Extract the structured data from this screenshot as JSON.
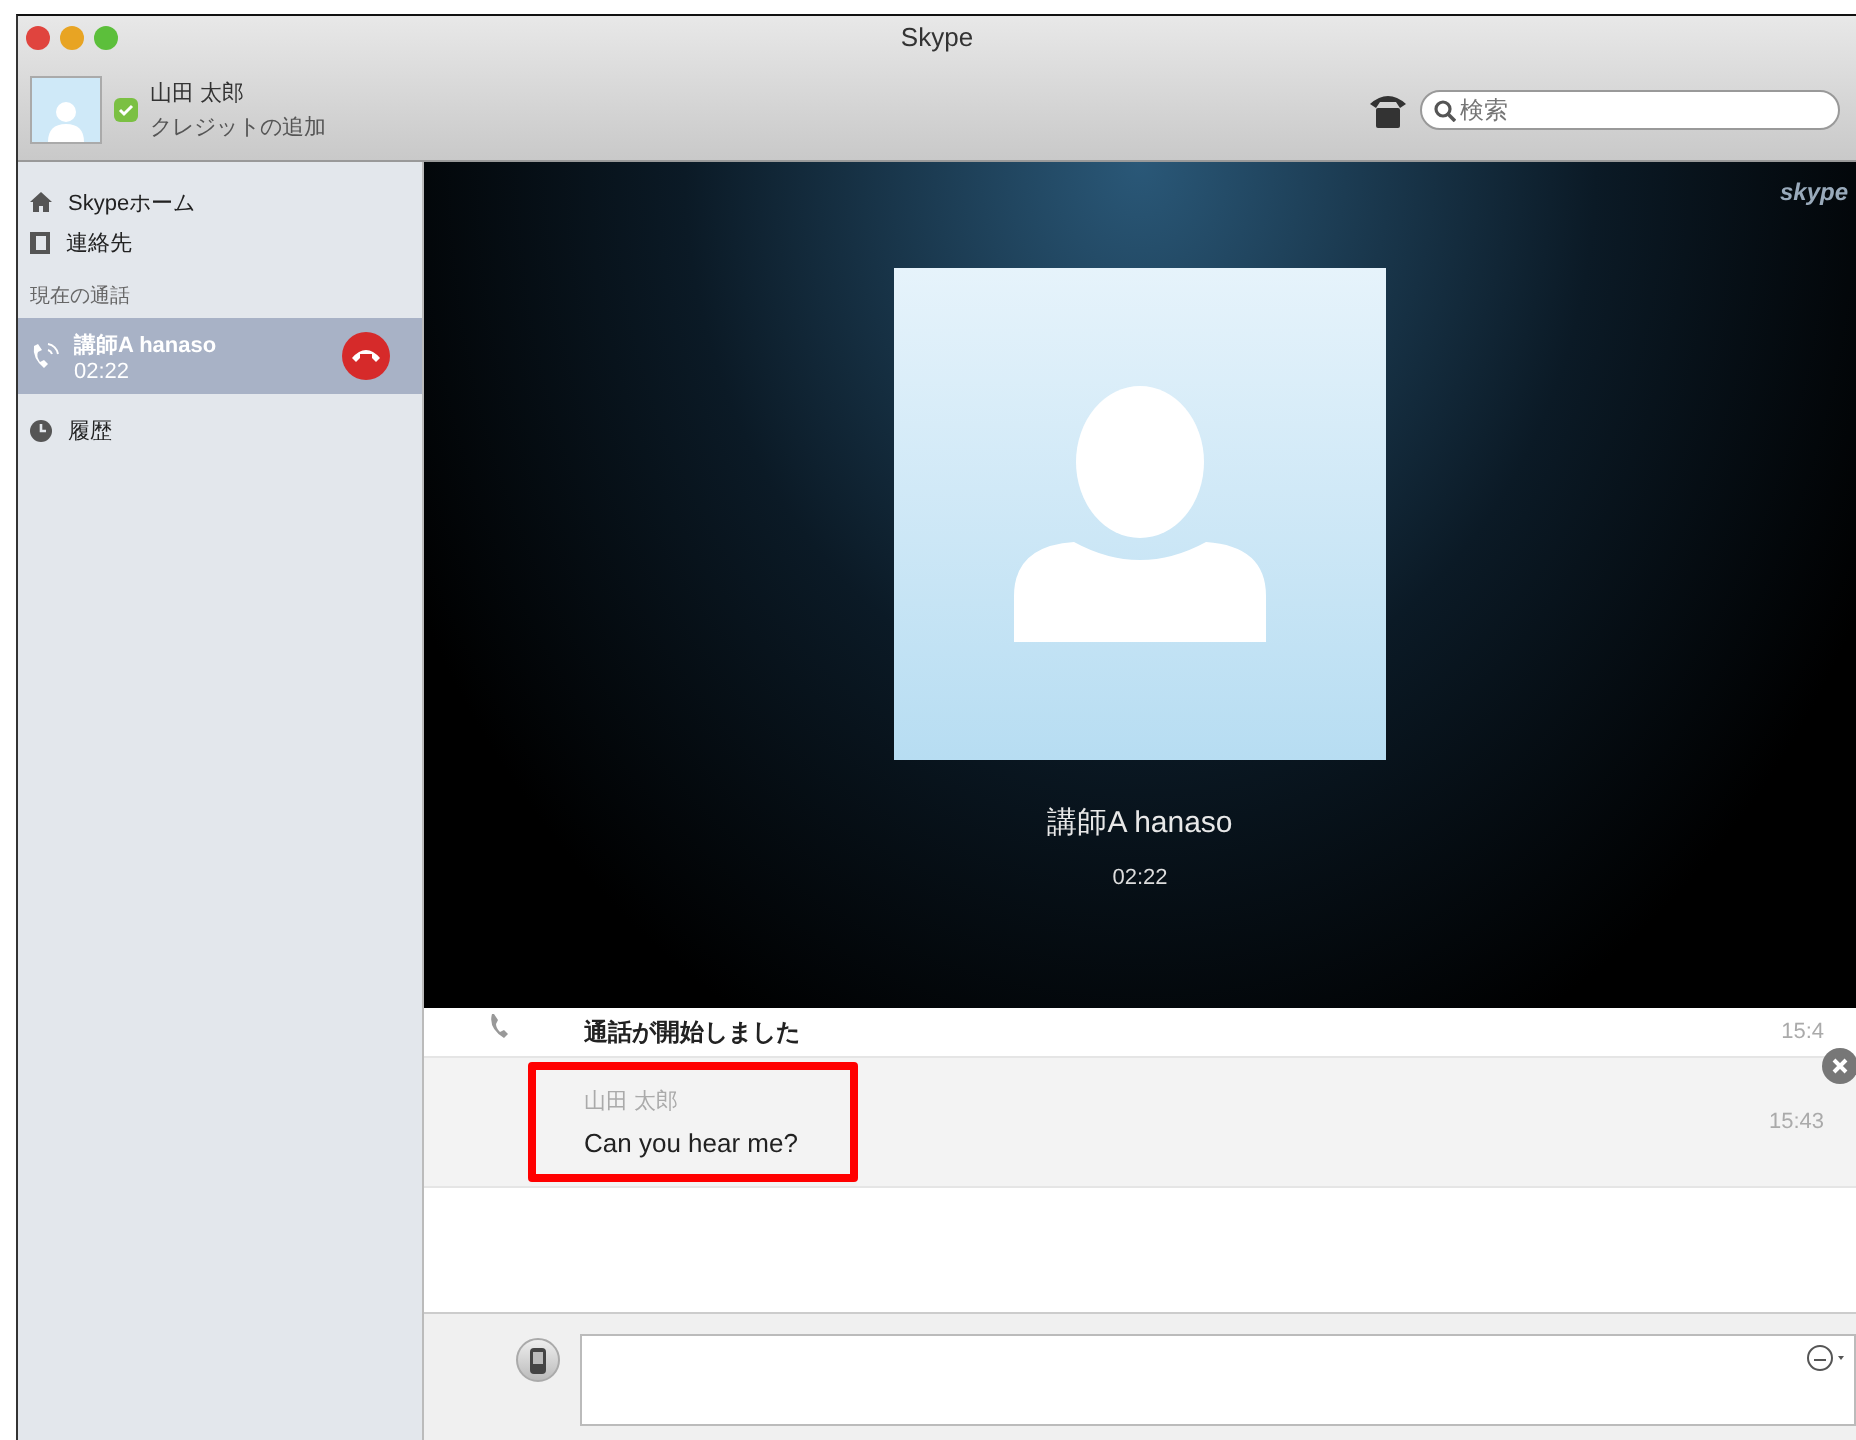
{
  "window": {
    "title": "Skype"
  },
  "account": {
    "name": "山田 太郎",
    "link": "クレジットの追加"
  },
  "search": {
    "placeholder": "検索"
  },
  "sidebar": {
    "items": [
      {
        "kind": "home",
        "label": "Skypeホーム"
      },
      {
        "kind": "contacts",
        "label": "連絡先"
      }
    ],
    "section": "現在の通話",
    "calls": [
      {
        "name": "講師A hanaso",
        "time": "02:22",
        "selected": true
      }
    ],
    "history": {
      "label": "履歴"
    }
  },
  "video": {
    "logo": "skype",
    "name": "講師A hanaso",
    "time": "02:22"
  },
  "messages": [
    {
      "kind": "event",
      "text": "通話が開始しました",
      "time": "15:4",
      "highlighted": false
    },
    {
      "kind": "message",
      "sender": "山田 太郎",
      "text": "Can you hear me?",
      "time": "15:43",
      "highlighted": true
    }
  ]
}
